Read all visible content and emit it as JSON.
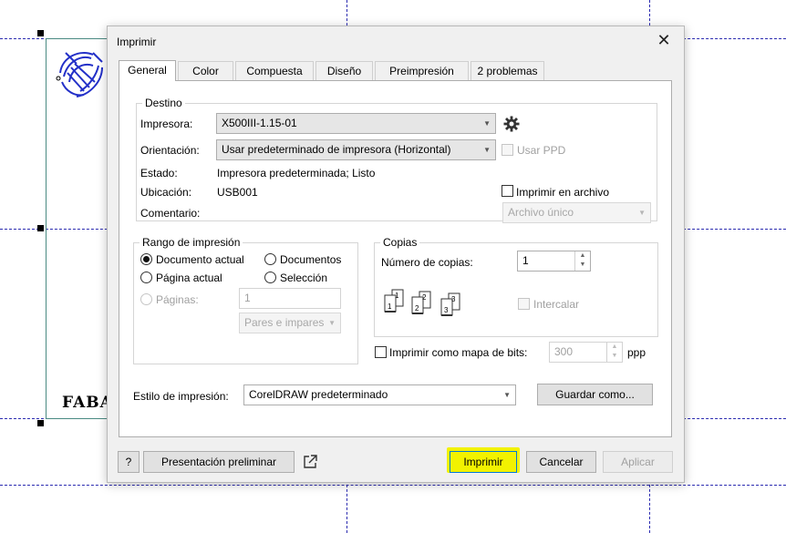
{
  "canvas": {
    "visible_text": "FABA"
  },
  "dialog": {
    "title": "Imprimir",
    "close_glyph": "✕",
    "tabs": [
      {
        "label": "General",
        "active": true
      },
      {
        "label": "Color",
        "active": false
      },
      {
        "label": "Compuesta",
        "active": false
      },
      {
        "label": "Diseño",
        "active": false
      },
      {
        "label": "Preimpresión",
        "active": false
      },
      {
        "label": "2 problemas",
        "active": false
      }
    ],
    "destino": {
      "legend": "Destino",
      "printer_label": "Impresora:",
      "printer_value": "X500III-1.15-01",
      "orientation_label": "Orientación:",
      "orientation_value": "Usar predeterminado de impresora (Horizontal)",
      "use_ppd_label": "Usar PPD",
      "status_label": "Estado:",
      "status_value": "Impresora predeterminada; Listo",
      "location_label": "Ubicación:",
      "location_value": "USB001",
      "comment_label": "Comentario:",
      "print_to_file_label": "Imprimir en archivo",
      "file_mode_value": "Archivo único"
    },
    "range": {
      "legend": "Rango de impresión",
      "current_document": "Documento actual",
      "documents": "Documentos",
      "current_page": "Página actual",
      "selection": "Selección",
      "pages_label": "Páginas:",
      "pages_value": "1",
      "parity_value": "Pares e impares"
    },
    "copies": {
      "legend": "Copias",
      "count_label": "Número de copias:",
      "count_value": "1",
      "collate_label": "Intercalar",
      "uncollated_pages": [
        "1",
        "1",
        "2",
        "2",
        "3",
        "3"
      ]
    },
    "bitmap": {
      "label": "Imprimir como mapa de bits:",
      "dpi_value": "300",
      "unit": "ppp"
    },
    "style": {
      "label": "Estilo de impresión:",
      "value": "CorelDRAW predeterminado",
      "save_as_label": "Guardar como..."
    },
    "footer": {
      "help_label": "?",
      "preview_label": "Presentación preliminar",
      "print_label": "Imprimir",
      "cancel_label": "Cancelar",
      "apply_label": "Aplicar"
    }
  },
  "colors": {
    "accent": "#0078d7",
    "highlight": "#f2f200",
    "guide": "#2b2bb0"
  }
}
